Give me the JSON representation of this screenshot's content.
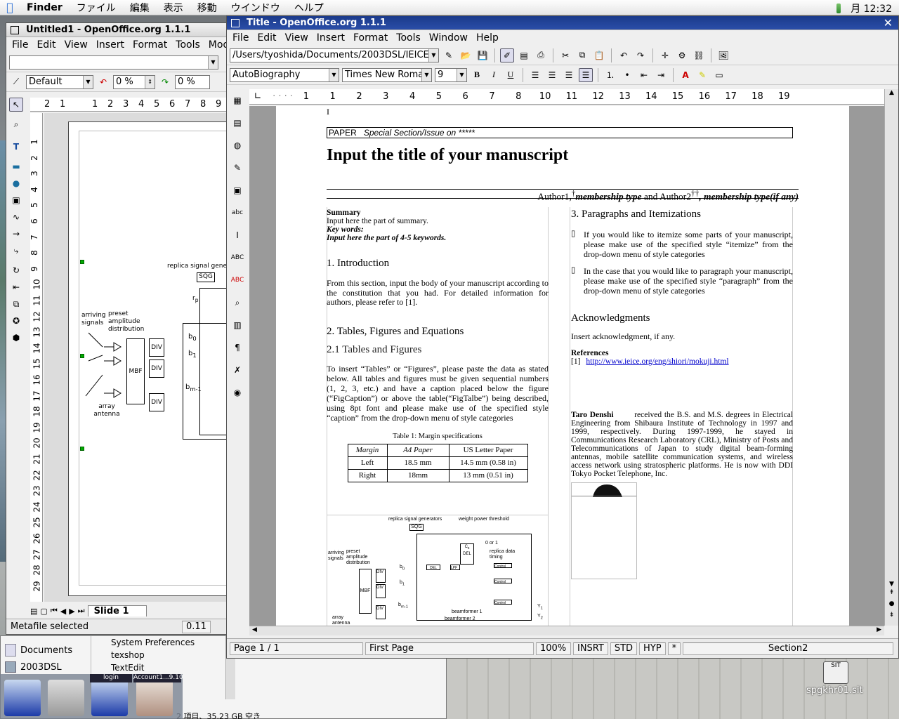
{
  "menubar": {
    "app": "Finder",
    "items": [
      "ファイル",
      "編集",
      "表示",
      "移動",
      "ウインドウ",
      "ヘルプ"
    ],
    "clock": "月 12:32"
  },
  "left_window": {
    "title": "Untitled1 - OpenOffice.org 1.1.1",
    "menu": [
      "File",
      "Edit",
      "View",
      "Insert",
      "Format",
      "Tools",
      "Modify"
    ],
    "style": "Default",
    "pct1": "0 %",
    "pct2": "0 %",
    "ruler_top": [
      "2",
      "1",
      "1",
      "2",
      "3",
      "4",
      "5",
      "6",
      "7",
      "8",
      "9"
    ],
    "ruler_left": [
      "1",
      "2",
      "3",
      "4",
      "5",
      "6",
      "7",
      "8",
      "9",
      "10",
      "11",
      "12",
      "13",
      "14",
      "15",
      "16",
      "17",
      "18",
      "19",
      "20",
      "21",
      "22",
      "23",
      "24",
      "25",
      "26",
      "27",
      "28",
      "29"
    ],
    "tab": "Slide 1",
    "status": "Metafile selected",
    "status2": "0.11",
    "diagram": {
      "replica": "replica signal gener",
      "sqg": "SQG",
      "arriving": "arriving signals",
      "preset": "preset amplitude distribution",
      "mbf": "MBF",
      "div": "DIV",
      "b0": "b",
      "b0sub": "0",
      "b1": "b",
      "b1sub": "1",
      "bm": "b",
      "bmsub": "m-1",
      "array": "array antenna",
      "rp": "r",
      "rpsub": "p"
    }
  },
  "main_window": {
    "title": "Title - OpenOffice.org 1.1.1",
    "menu": [
      "File",
      "Edit",
      "View",
      "Insert",
      "Format",
      "Tools",
      "Window",
      "Help"
    ],
    "path": "/Users/tyoshida/Documents/2003DSL/IEICE2",
    "para_style": "AutoBiography",
    "font": "Times New Roma",
    "size": "9",
    "ruler": [
      "1",
      "1",
      "2",
      "3",
      "4",
      "5",
      "6",
      "7",
      "8",
      "10",
      "11",
      "12",
      "13",
      "14",
      "15",
      "16",
      "17",
      "18",
      "19"
    ],
    "status": {
      "page": "Page 1 / 1",
      "style": "First Page",
      "zoom": "100%",
      "insrt": "INSRT",
      "std": "STD",
      "hyp": "HYP",
      "star": "*",
      "section": "Section2"
    }
  },
  "doc": {
    "cursor_line": "I",
    "header_paper": "PAPER",
    "header_special": "Special Section/Issue on *****",
    "title": "Input the title of your manuscript",
    "authors_plain1": "Author1,",
    "authors_sup1": "†",
    "authors_it1": "membership type",
    "authors_plain2": " and Author2",
    "authors_sup2": "††",
    "authors_it2": ", membership type(if any)",
    "summary_h": "Summary",
    "summary": "Input here the part of summary.",
    "kw_h": "Key words:",
    "kw": "Input here the part of 4-5 keywords.",
    "s1": "1. Introduction",
    "s1_body": "From this section, input the body of your manuscript according to the constitution that you had. For detailed information for authors, please refer to [1].",
    "s2": "2. Tables, Figures and Equations",
    "s21": "2.1 Tables and Figures",
    "s21_body": "To insert “Tables” or “Figures”, please paste the data as stated below. All tables and figures must be given sequential numbers (1, 2, 3, etc.) and have a caption placed below the figure (“FigCaption”) or above the table(“FigTalbe”) being described, using 8pt font and please make use of the specified style “caption” from the drop-down menu of style categories",
    "table_caption": "Table 1: Margin specifications",
    "table_head": [
      "Margin",
      "A4 Paper",
      "US Letter Paper"
    ],
    "table_rows": [
      [
        "Left",
        "18.5 mm",
        "14.5 mm (0.58 in)"
      ],
      [
        "Right",
        "18mm",
        "13 mm (0.51 in)"
      ]
    ],
    "s3": "3. Paragraphs and Itemizations",
    "item1": "If you would like to itemize some parts of your manuscript, please make use of the specified style “itemize” from the drop-down menu of style categories",
    "item2": "In the case that you would like to paragraph your manuscript, please make use of the specified style “paragraph” from the drop-down menu of style categories",
    "ack_h": "Acknowledgments",
    "ack": "Insert acknowledgment, if any.",
    "ref_h": "References",
    "ref1_num": "[1]",
    "ref1": "http://www.ieice.org/eng/shiori/mokuji.html",
    "bio_name": "Taro Denshi",
    "bio": "received the B.S. and M.S. degrees in Electrical Engineering from Shibaura Institute of Technology in 1997 and 1999, respectively. During 1997-1999, he stayed in Communications Research Laboratory (CRL), Ministry of Posts and Telecommunications of Japan to study digital beam-forming antennas, mobile satellite communication systems, and wireless access network using stratospheric platforms. He is now with DDI Tokyo Pocket Telephone, Inc.",
    "fig": {
      "replica": "replica signal generators",
      "weight": "weight power threshold",
      "sqg": "SQG",
      "arriving": "arriving signals",
      "preset": "preset amplitude distribution",
      "mbf": "MBF",
      "div": "DIV",
      "beamformer1": "beamformer 1",
      "beamformer2": "beamformer 2",
      "array": "array antenna",
      "control": "Control",
      "dl": "DEL",
      "lpf": "LPF",
      "replica_timing": "replica data timing",
      "cs": "C",
      "csub": "s",
      "del": "DEL",
      "oor": "0 or 1",
      "y1": "Y",
      "y1sub": "1",
      "y2": "Y",
      "y2sub": "2",
      "b0": "b",
      "b0sub": "0",
      "b1": "b",
      "b1sub": "1",
      "bm": "b",
      "bmsub": "m-1"
    }
  },
  "finder": {
    "items": [
      "Documents",
      "2003DSL"
    ],
    "menu": [
      "System Preferences",
      "texshop",
      "TextEdit"
    ],
    "status": "2 項目、35.23 GB 空き",
    "dock_labels": [
      "login",
      "Account1...9.10"
    ]
  },
  "desktop_icon": {
    "label": "spgkhr01.sit",
    "badge": "SIT"
  }
}
